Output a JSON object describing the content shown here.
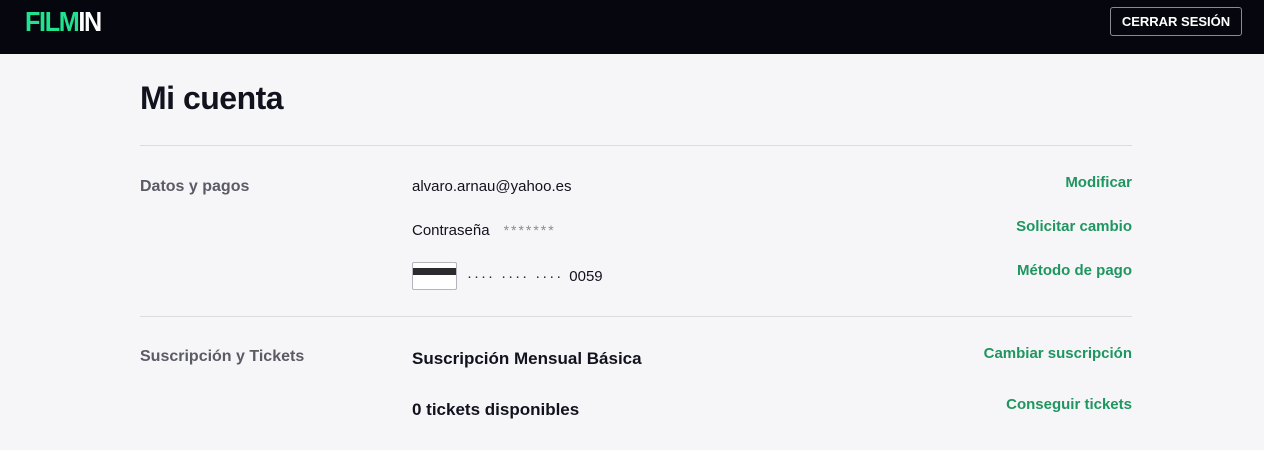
{
  "header": {
    "logo": {
      "part_a": "FILM",
      "part_b": "IN"
    },
    "logout_label": "CERRAR SESIÓN"
  },
  "page": {
    "title": "Mi cuenta"
  },
  "sections": {
    "datos": {
      "label": "Datos y pagos",
      "email": "alvaro.arnau@yahoo.es",
      "email_action": "Modificar",
      "password_label": "Contraseña",
      "password_mask": "*******",
      "password_action": "Solicitar cambio",
      "card_mask": "···· ···· ····",
      "card_last4": "0059",
      "card_action": "Método de pago"
    },
    "suscripcion": {
      "label": "Suscripción y Tickets",
      "plan": "Suscripción Mensual Básica",
      "plan_action": "Cambiar suscripción",
      "tickets": "0 tickets disponibles",
      "tickets_action": "Conseguir tickets"
    }
  },
  "colors": {
    "header_bg": "#06060f",
    "brand_green": "#1fe38e",
    "link_green": "#1f9560",
    "page_bg": "#f6f6f8"
  },
  "icons": [
    "credit-card-icon"
  ]
}
